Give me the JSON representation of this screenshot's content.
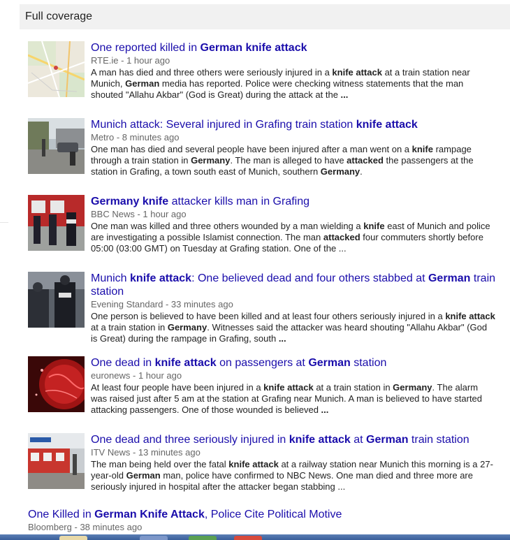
{
  "section": {
    "title": "Full coverage"
  },
  "articles": [
    {
      "headline": [
        {
          "t": "One reported killed in ",
          "b": false
        },
        {
          "t": "German knife attack",
          "b": true
        }
      ],
      "source": "RTE.ie",
      "time": "1 hour ago",
      "snippet": [
        {
          "t": "A man has died and three others were seriously injured in a ",
          "b": false
        },
        {
          "t": "knife attack",
          "b": true
        },
        {
          "t": " at a train station near Munich, ",
          "b": false
        },
        {
          "t": "German",
          "b": true
        },
        {
          "t": " media has reported. Police were checking witness statements that the man shouted \"Allahu Akbar\" (God is Great) during the attack at the ",
          "b": false
        },
        {
          "t": "...",
          "b": true
        }
      ],
      "thumb": "map-thumbnail"
    },
    {
      "headline": [
        {
          "t": "Munich attack: Several injured in Grafing train station ",
          "b": false
        },
        {
          "t": "knife attack",
          "b": true
        }
      ],
      "source": "Metro",
      "time": "8 minutes ago",
      "snippet": [
        {
          "t": "One man has died and several people have been injured after a man went on a ",
          "b": false
        },
        {
          "t": "knife",
          "b": true
        },
        {
          "t": " rampage through a train station in ",
          "b": false
        },
        {
          "t": "Germany",
          "b": true
        },
        {
          "t": ". The man is alleged to have ",
          "b": false
        },
        {
          "t": "attacked",
          "b": true
        },
        {
          "t": " the passengers at the station in Grafing, a town south east of Munich, southern ",
          "b": false
        },
        {
          "t": "Germany",
          "b": true
        },
        {
          "t": ".",
          "b": false
        }
      ],
      "thumb": "street-scene-thumbnail"
    },
    {
      "headline": [
        {
          "t": "Germany knife",
          "b": true
        },
        {
          "t": " attacker kills man in Grafing",
          "b": false
        }
      ],
      "source": "BBC News",
      "time": "1 hour ago",
      "snippet": [
        {
          "t": "One man was killed and three others wounded by a man wielding a ",
          "b": false
        },
        {
          "t": "knife",
          "b": true
        },
        {
          "t": " east of Munich and police are investigating a possible Islamist connection. The man ",
          "b": false
        },
        {
          "t": "attacked",
          "b": true
        },
        {
          "t": " four commuters shortly before 05:00 (03:00 GMT) on Tuesday at Grafing station. One of the ...",
          "b": false
        }
      ],
      "thumb": "police-train-thumbnail"
    },
    {
      "headline": [
        {
          "t": "Munich ",
          "b": false
        },
        {
          "t": "knife attack",
          "b": true
        },
        {
          "t": ": One believed dead and four others stabbed at ",
          "b": false
        },
        {
          "t": "German",
          "b": true
        },
        {
          "t": " train station",
          "b": false
        }
      ],
      "source": "Evening Standard",
      "time": "33 minutes ago",
      "snippet": [
        {
          "t": "One person is believed to have been killed and at least four others seriously injured in a ",
          "b": false
        },
        {
          "t": "knife attack",
          "b": true
        },
        {
          "t": " at a train station in ",
          "b": false
        },
        {
          "t": "Germany",
          "b": true
        },
        {
          "t": ". Witnesses said the attacker was heard shouting \"Allahu Akbar\" (God is Great) during the rampage in Grafing, south ",
          "b": false
        },
        {
          "t": "...",
          "b": true
        }
      ],
      "thumb": "polizei-officers-thumbnail"
    },
    {
      "headline": [
        {
          "t": "One dead in ",
          "b": false
        },
        {
          "t": "knife attack",
          "b": true
        },
        {
          "t": " on passengers at ",
          "b": false
        },
        {
          "t": "German",
          "b": true
        },
        {
          "t": " station",
          "b": false
        }
      ],
      "source": "euronews",
      "time": "1 hour ago",
      "snippet": [
        {
          "t": "At least four people have been injured in a ",
          "b": false
        },
        {
          "t": "knife attack",
          "b": true
        },
        {
          "t": " at a train station in ",
          "b": false
        },
        {
          "t": "Germany",
          "b": true
        },
        {
          "t": ". The alarm was raised just after 5 am at the station at Grafing near Munich. A man is believed to have started attacking passengers. One of those wounded is believed ",
          "b": false
        },
        {
          "t": "...",
          "b": true
        }
      ],
      "thumb": "red-globe-thumbnail"
    },
    {
      "headline": [
        {
          "t": "One dead and three seriously injured in ",
          "b": false
        },
        {
          "t": "knife attack",
          "b": true
        },
        {
          "t": " at ",
          "b": false
        },
        {
          "t": "German",
          "b": true
        },
        {
          "t": " train station",
          "b": false
        }
      ],
      "source": "ITV News",
      "time": "13 minutes ago",
      "snippet": [
        {
          "t": "The man being held over the fatal ",
          "b": false
        },
        {
          "t": "knife attack",
          "b": true
        },
        {
          "t": " at a railway station near Munich this morning is a 27-year-old ",
          "b": false
        },
        {
          "t": "German",
          "b": true
        },
        {
          "t": " man, police have confirmed to NBC News. One man died and three more are seriously injured in hospital after the attacker began stabbing ...",
          "b": false
        }
      ],
      "thumb": "station-platform-thumbnail"
    },
    {
      "headline": [
        {
          "t": "One Killed in ",
          "b": false
        },
        {
          "t": "German Knife Attack",
          "b": true
        },
        {
          "t": ", Police Cite Political Motive",
          "b": false
        }
      ],
      "source": "Bloomberg",
      "time": "38 minutes ago",
      "snippet": [],
      "thumb": ""
    }
  ],
  "colors": {
    "link": "#1a0dab",
    "source": "#666666",
    "text": "#222222",
    "header_bg": "#f1f1f1"
  }
}
